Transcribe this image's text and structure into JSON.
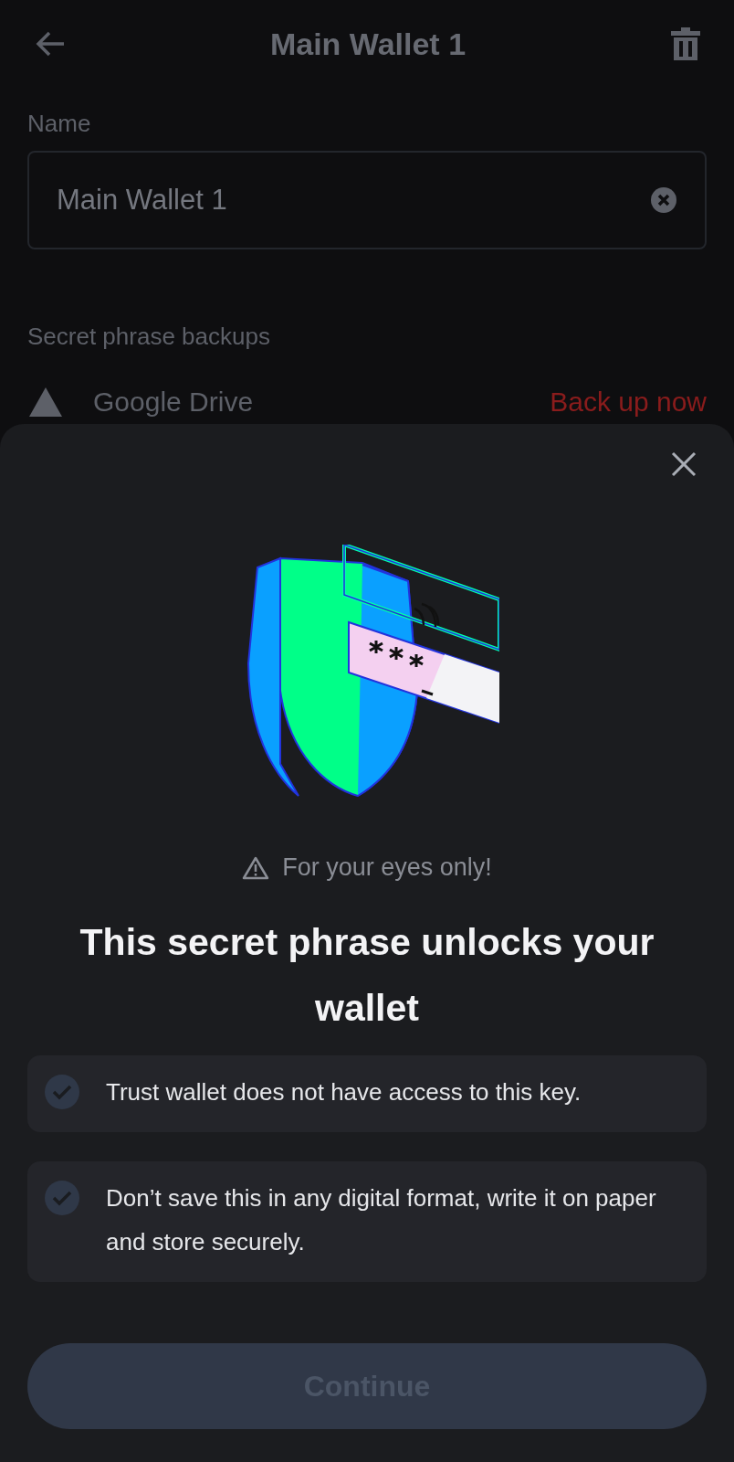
{
  "header": {
    "title": "Main Wallet 1"
  },
  "name_field": {
    "label": "Name",
    "value": "Main Wallet 1"
  },
  "backups": {
    "heading": "Secret phrase backups",
    "items": [
      {
        "name": "Google Drive",
        "action": "Back up now"
      }
    ]
  },
  "sheet": {
    "warning": "For your eyes only!",
    "title": "This secret phrase unlocks your wallet",
    "items": [
      {
        "text": "Trust wallet does not have access to this key.",
        "checked": false
      },
      {
        "text": "Don’t save this in any digital format, write it on paper and store securely.",
        "checked": false
      }
    ],
    "button": {
      "label": "Continue",
      "disabled": true
    }
  }
}
